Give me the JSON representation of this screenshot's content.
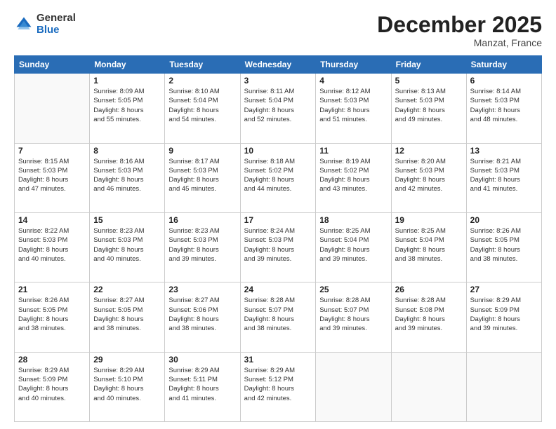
{
  "header": {
    "logo_general": "General",
    "logo_blue": "Blue",
    "month_title": "December 2025",
    "location": "Manzat, France"
  },
  "days_of_week": [
    "Sunday",
    "Monday",
    "Tuesday",
    "Wednesday",
    "Thursday",
    "Friday",
    "Saturday"
  ],
  "weeks": [
    [
      {
        "num": "",
        "info": ""
      },
      {
        "num": "1",
        "info": "Sunrise: 8:09 AM\nSunset: 5:05 PM\nDaylight: 8 hours\nand 55 minutes."
      },
      {
        "num": "2",
        "info": "Sunrise: 8:10 AM\nSunset: 5:04 PM\nDaylight: 8 hours\nand 54 minutes."
      },
      {
        "num": "3",
        "info": "Sunrise: 8:11 AM\nSunset: 5:04 PM\nDaylight: 8 hours\nand 52 minutes."
      },
      {
        "num": "4",
        "info": "Sunrise: 8:12 AM\nSunset: 5:03 PM\nDaylight: 8 hours\nand 51 minutes."
      },
      {
        "num": "5",
        "info": "Sunrise: 8:13 AM\nSunset: 5:03 PM\nDaylight: 8 hours\nand 49 minutes."
      },
      {
        "num": "6",
        "info": "Sunrise: 8:14 AM\nSunset: 5:03 PM\nDaylight: 8 hours\nand 48 minutes."
      }
    ],
    [
      {
        "num": "7",
        "info": "Sunrise: 8:15 AM\nSunset: 5:03 PM\nDaylight: 8 hours\nand 47 minutes."
      },
      {
        "num": "8",
        "info": "Sunrise: 8:16 AM\nSunset: 5:03 PM\nDaylight: 8 hours\nand 46 minutes."
      },
      {
        "num": "9",
        "info": "Sunrise: 8:17 AM\nSunset: 5:03 PM\nDaylight: 8 hours\nand 45 minutes."
      },
      {
        "num": "10",
        "info": "Sunrise: 8:18 AM\nSunset: 5:02 PM\nDaylight: 8 hours\nand 44 minutes."
      },
      {
        "num": "11",
        "info": "Sunrise: 8:19 AM\nSunset: 5:02 PM\nDaylight: 8 hours\nand 43 minutes."
      },
      {
        "num": "12",
        "info": "Sunrise: 8:20 AM\nSunset: 5:03 PM\nDaylight: 8 hours\nand 42 minutes."
      },
      {
        "num": "13",
        "info": "Sunrise: 8:21 AM\nSunset: 5:03 PM\nDaylight: 8 hours\nand 41 minutes."
      }
    ],
    [
      {
        "num": "14",
        "info": "Sunrise: 8:22 AM\nSunset: 5:03 PM\nDaylight: 8 hours\nand 40 minutes."
      },
      {
        "num": "15",
        "info": "Sunrise: 8:23 AM\nSunset: 5:03 PM\nDaylight: 8 hours\nand 40 minutes."
      },
      {
        "num": "16",
        "info": "Sunrise: 8:23 AM\nSunset: 5:03 PM\nDaylight: 8 hours\nand 39 minutes."
      },
      {
        "num": "17",
        "info": "Sunrise: 8:24 AM\nSunset: 5:03 PM\nDaylight: 8 hours\nand 39 minutes."
      },
      {
        "num": "18",
        "info": "Sunrise: 8:25 AM\nSunset: 5:04 PM\nDaylight: 8 hours\nand 39 minutes."
      },
      {
        "num": "19",
        "info": "Sunrise: 8:25 AM\nSunset: 5:04 PM\nDaylight: 8 hours\nand 38 minutes."
      },
      {
        "num": "20",
        "info": "Sunrise: 8:26 AM\nSunset: 5:05 PM\nDaylight: 8 hours\nand 38 minutes."
      }
    ],
    [
      {
        "num": "21",
        "info": "Sunrise: 8:26 AM\nSunset: 5:05 PM\nDaylight: 8 hours\nand 38 minutes."
      },
      {
        "num": "22",
        "info": "Sunrise: 8:27 AM\nSunset: 5:05 PM\nDaylight: 8 hours\nand 38 minutes."
      },
      {
        "num": "23",
        "info": "Sunrise: 8:27 AM\nSunset: 5:06 PM\nDaylight: 8 hours\nand 38 minutes."
      },
      {
        "num": "24",
        "info": "Sunrise: 8:28 AM\nSunset: 5:07 PM\nDaylight: 8 hours\nand 38 minutes."
      },
      {
        "num": "25",
        "info": "Sunrise: 8:28 AM\nSunset: 5:07 PM\nDaylight: 8 hours\nand 39 minutes."
      },
      {
        "num": "26",
        "info": "Sunrise: 8:28 AM\nSunset: 5:08 PM\nDaylight: 8 hours\nand 39 minutes."
      },
      {
        "num": "27",
        "info": "Sunrise: 8:29 AM\nSunset: 5:09 PM\nDaylight: 8 hours\nand 39 minutes."
      }
    ],
    [
      {
        "num": "28",
        "info": "Sunrise: 8:29 AM\nSunset: 5:09 PM\nDaylight: 8 hours\nand 40 minutes."
      },
      {
        "num": "29",
        "info": "Sunrise: 8:29 AM\nSunset: 5:10 PM\nDaylight: 8 hours\nand 40 minutes."
      },
      {
        "num": "30",
        "info": "Sunrise: 8:29 AM\nSunset: 5:11 PM\nDaylight: 8 hours\nand 41 minutes."
      },
      {
        "num": "31",
        "info": "Sunrise: 8:29 AM\nSunset: 5:12 PM\nDaylight: 8 hours\nand 42 minutes."
      },
      {
        "num": "",
        "info": ""
      },
      {
        "num": "",
        "info": ""
      },
      {
        "num": "",
        "info": ""
      }
    ]
  ]
}
